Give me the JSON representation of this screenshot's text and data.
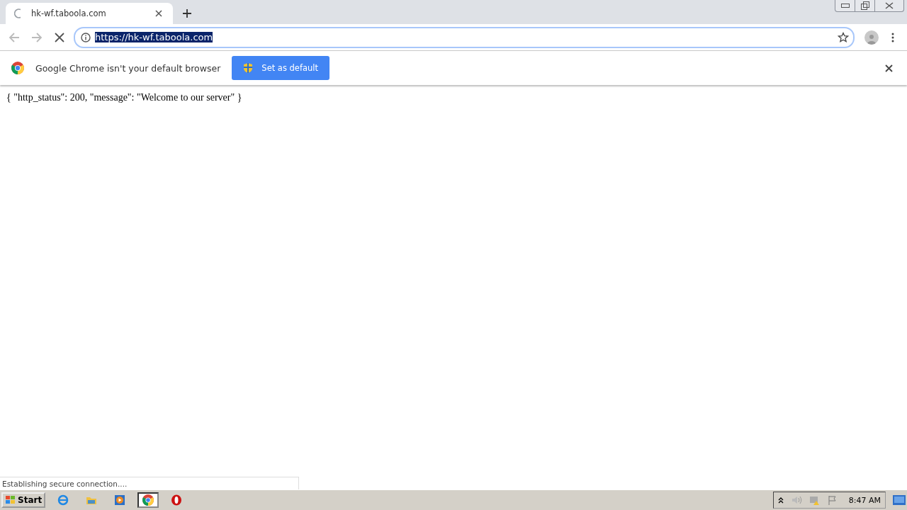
{
  "tab": {
    "title": "hk-wf.taboola.com",
    "loading": true
  },
  "address_bar": {
    "url": "https://hk-wf.taboola.com",
    "selected": true
  },
  "infobar": {
    "message": "Google Chrome isn't your default browser",
    "button": "Set as default"
  },
  "page": {
    "text": "{ \"http_status\": 200, \"message\": \"Welcome to our server\" }"
  },
  "status_bubble": "Establishing secure connection....",
  "taskbar": {
    "start": "Start",
    "apps": [
      {
        "kind": "ie",
        "selected": false
      },
      {
        "kind": "folder",
        "selected": false
      },
      {
        "kind": "media",
        "selected": false
      },
      {
        "kind": "chrome",
        "selected": true
      },
      {
        "kind": "opera",
        "selected": false
      }
    ],
    "clock": "8:47 AM"
  }
}
